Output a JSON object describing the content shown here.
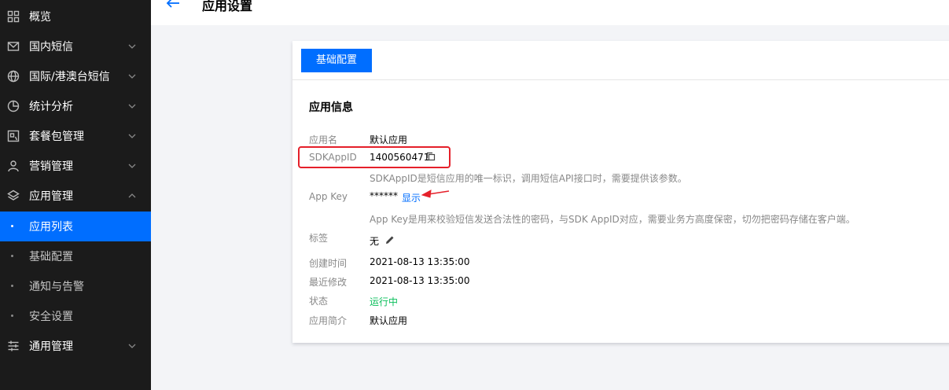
{
  "header": {
    "title": "应用设置"
  },
  "sidebar": {
    "items": [
      {
        "label": "概览",
        "icon": "grid-icon"
      },
      {
        "label": "国内短信",
        "icon": "mail-icon"
      },
      {
        "label": "国际/港澳台短信",
        "icon": "globe-icon"
      },
      {
        "label": "统计分析",
        "icon": "pie-chart-icon"
      },
      {
        "label": "套餐包管理",
        "icon": "package-icon"
      },
      {
        "label": "营销管理",
        "icon": "user-marketing-icon"
      },
      {
        "label": "应用管理",
        "icon": "layers-icon"
      },
      {
        "label": "应用列表"
      },
      {
        "label": "基础配置"
      },
      {
        "label": "通知与告警"
      },
      {
        "label": "安全设置"
      },
      {
        "label": "通用管理",
        "icon": "sliders-icon"
      }
    ]
  },
  "card": {
    "tab_label": "基础配置",
    "section_title": "应用信息",
    "app_name_label": "应用名",
    "app_name_value": "默认应用",
    "sdk_label": "SDKAppID",
    "sdk_value": "1400560471",
    "sdk_hint": "SDKAppID是短信应用的唯一标识，调用短信API接口时，需要提供该参数。",
    "appkey_label": "App Key",
    "appkey_value": "******",
    "appkey_show": "显示",
    "appkey_hint": "App Key是用来校验短信发送合法性的密码，与SDK AppID对应，需要业务方高度保密，切勿把密码存储在客户端。",
    "tag_label": "标签",
    "tag_value": "无",
    "created_label": "创建时间",
    "created_value": "2021-08-13 13:35:00",
    "modified_label": "最近修改",
    "modified_value": "2021-08-13 13:35:00",
    "status_label": "状态",
    "status_value": "运行中",
    "intro_label": "应用简介",
    "intro_value": "默认应用"
  },
  "colors": {
    "accent": "#006eff",
    "status_ok": "#0abf5b",
    "annotation": "#e5202a",
    "sidebar_bg": "#1b1b1b"
  }
}
